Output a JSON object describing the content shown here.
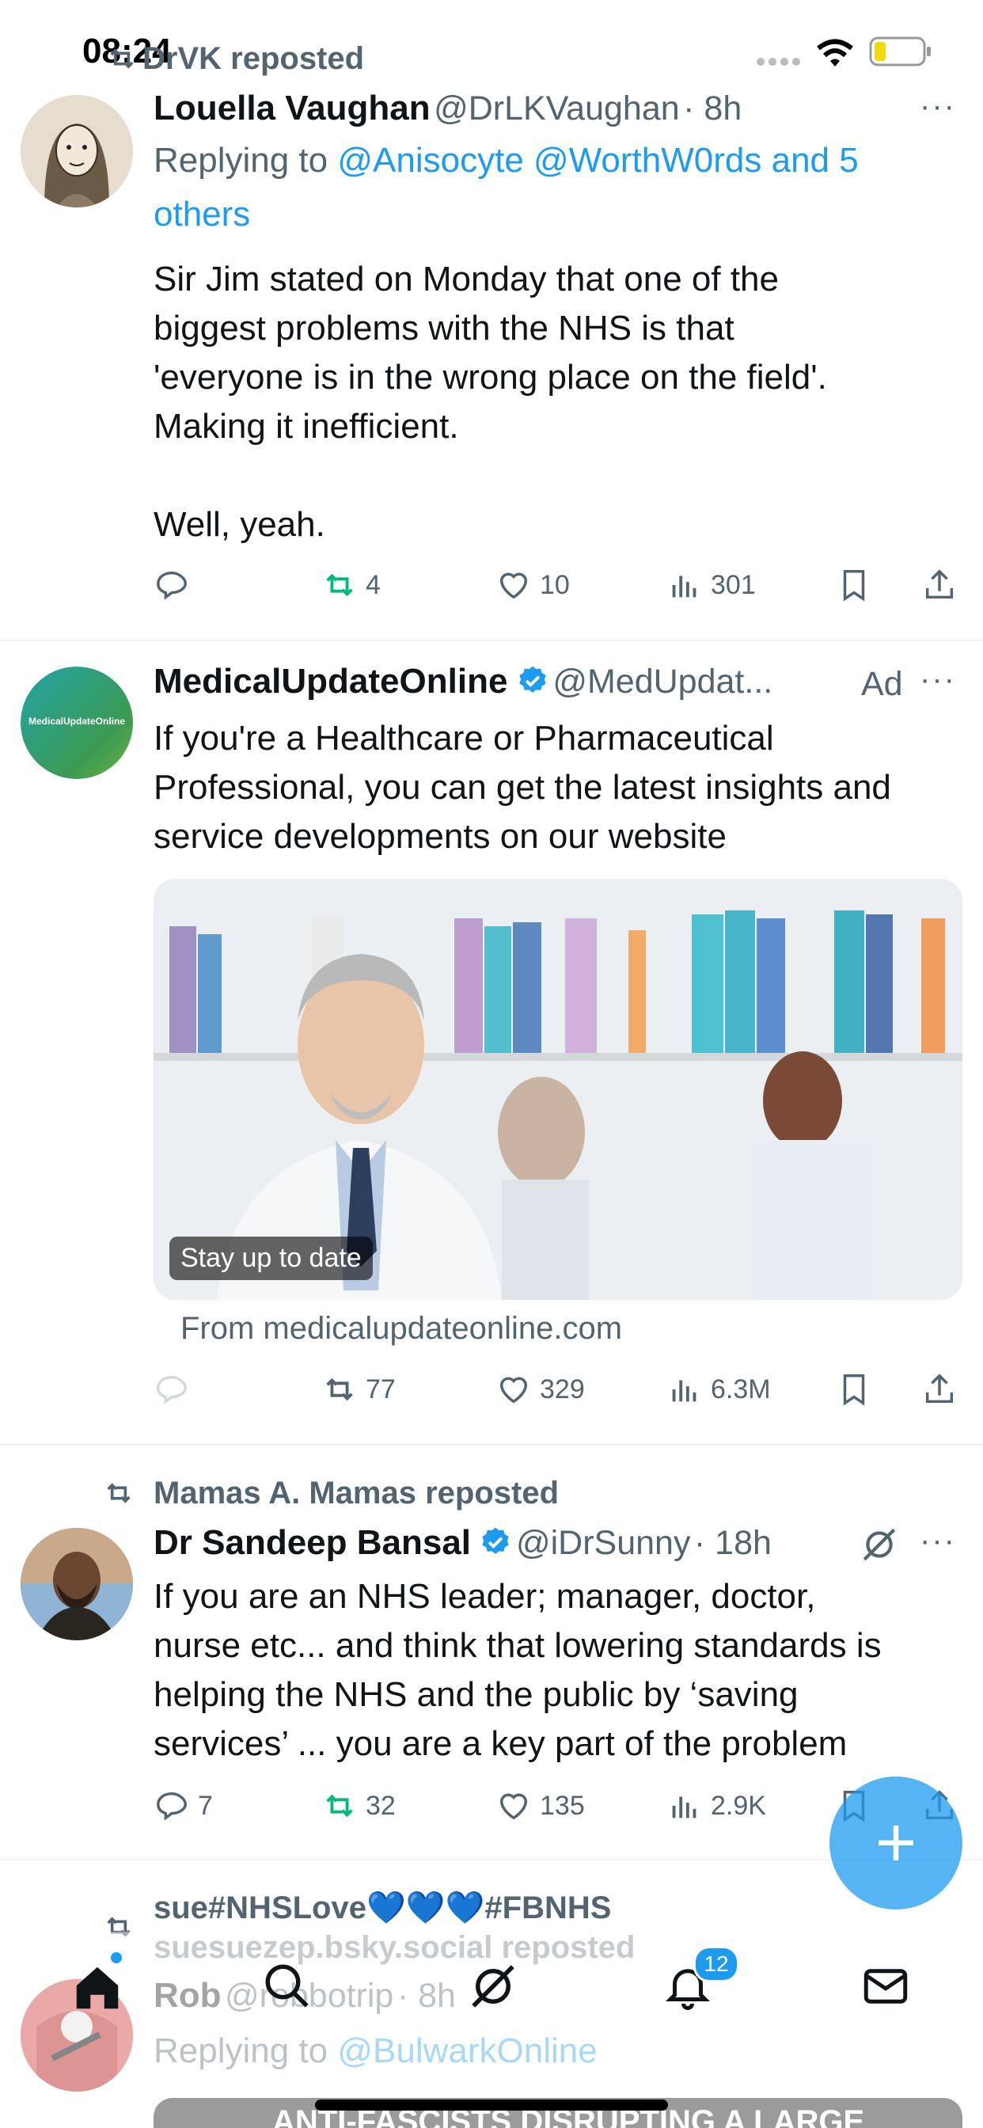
{
  "status_bar": {
    "time": "08:24"
  },
  "tweet1": {
    "repost_label": "DrVK reposted",
    "name": "Louella Vaughan",
    "handle": "@DrLKVaughan",
    "time": "· 8h",
    "replying_prefix": "Replying to",
    "replying_to": "@Anisocyte @WorthW0rds and 5",
    "replying_to_2": "others",
    "text_lines": [
      "Sir Jim stated on Monday that one of the",
      "biggest problems with the NHS is that",
      "'everyone is in the wrong place on the field'.",
      "Making it inefficient."
    ],
    "text_line_last": "Well, yeah.",
    "stats": {
      "replies": "",
      "reposts": "4",
      "likes": "10",
      "views": "301"
    }
  },
  "tweet2": {
    "name": "MedicalUpdateOnline",
    "handle": "@MedUpdat...",
    "ad_label": "Ad",
    "avatar_text": "MedicalUpdateOnline",
    "text_lines": [
      "If you're a Healthcare or Pharmaceutical",
      "Professional, you can get the latest insights and",
      "service developments on our website"
    ],
    "image_caption": "Stay up to date",
    "source": "From medicalupdateonline.com",
    "stats": {
      "reposts": "77",
      "likes": "329",
      "views": "6.3M"
    }
  },
  "tweet3": {
    "repost_label": "Mamas A. Mamas reposted",
    "name": "Dr Sandeep Bansal",
    "handle": "@iDrSunny",
    "time": "· 18h",
    "text_lines": [
      "If you are an NHS leader; manager, doctor,",
      "nurse etc... and think that lowering standards is",
      "helping the NHS and the public by ‘saving",
      "services’ ... you are a key part of the problem"
    ],
    "stats": {
      "replies": "7",
      "reposts": "32",
      "likes": "135",
      "views": "2.9K"
    }
  },
  "tweet4": {
    "repost_label_1": "sue#NHSLove💙💙💙#FBNHS",
    "repost_label_2": "suesuezep.bsky.social reposted",
    "name": "Rob",
    "handle": "@robbotrip",
    "time": "· 8h",
    "replying_prefix": "Replying to",
    "replying_to": "@BulwarkOnline",
    "image_text": "ANTI-FASCISTS DISRUPTING A LARGE"
  },
  "fab": {
    "label": "+"
  },
  "bottom_nav": {
    "notifications_badge": "12"
  },
  "colors": {
    "accent": "#1d9bf0",
    "repost_green": "#00ba7c",
    "muted": "#536471"
  }
}
